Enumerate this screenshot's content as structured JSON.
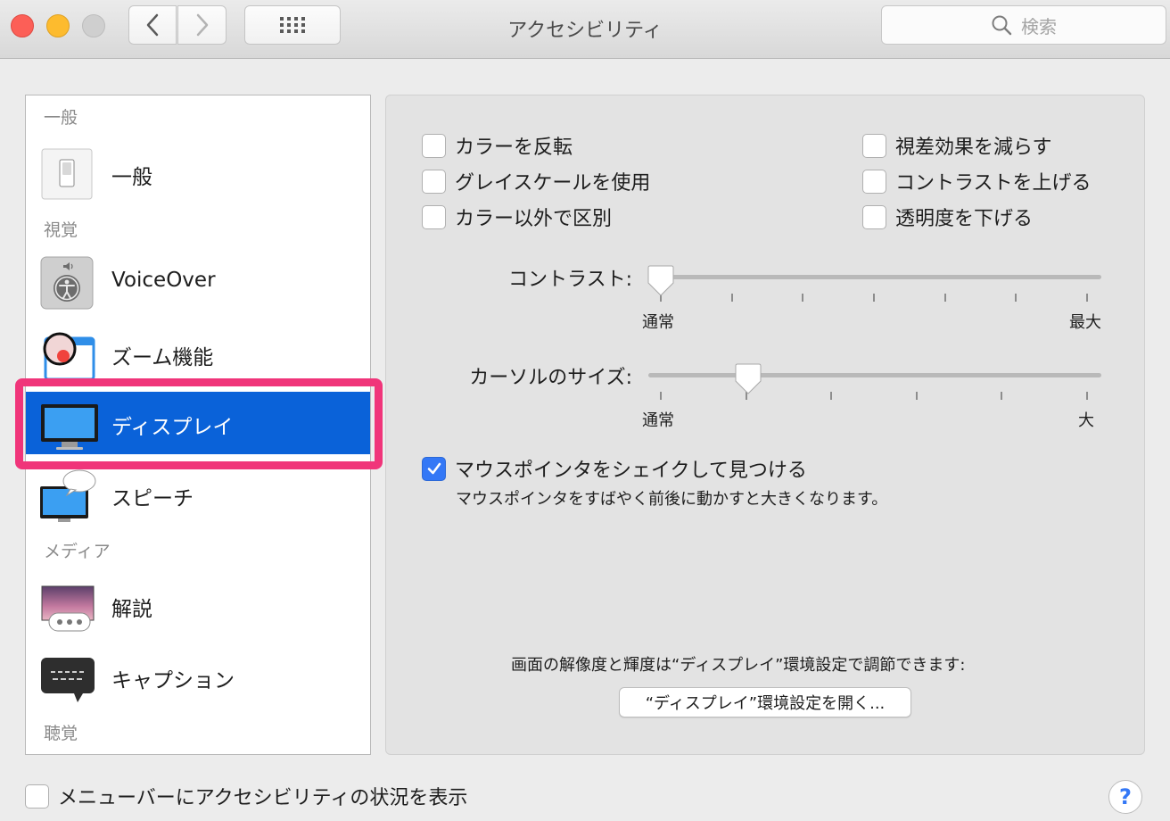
{
  "window": {
    "title": "アクセシビリティ",
    "search_placeholder": "検索"
  },
  "sidebar": {
    "sections": [
      {
        "title": "一般"
      },
      {
        "title": "視覚"
      },
      {
        "title": "メディア"
      },
      {
        "title": "聴覚"
      }
    ],
    "items": [
      {
        "label": "一般",
        "icon": "switch-icon"
      },
      {
        "label": "VoiceOver",
        "icon": "voiceover-icon"
      },
      {
        "label": "ズーム機能",
        "icon": "zoom-icon"
      },
      {
        "label": "ディスプレイ",
        "icon": "display-icon",
        "selected": true
      },
      {
        "label": "スピーチ",
        "icon": "speech-icon"
      },
      {
        "label": "解説",
        "icon": "descriptions-icon"
      },
      {
        "label": "キャプション",
        "icon": "captions-icon"
      }
    ]
  },
  "display": {
    "checkboxes": [
      {
        "label": "カラーを反転",
        "checked": false
      },
      {
        "label": "グレイスケールを使用",
        "checked": false
      },
      {
        "label": "カラー以外で区別",
        "checked": false
      },
      {
        "label": "視差効果を減らす",
        "checked": false
      },
      {
        "label": "コントラストを上げる",
        "checked": false
      },
      {
        "label": "透明度を下げる",
        "checked": false
      }
    ],
    "contrast": {
      "label": "コントラスト:",
      "min_label": "通常",
      "max_label": "最大",
      "value": 0.0
    },
    "cursor_size": {
      "label": "カーソルのサイズ:",
      "min_label": "通常",
      "max_label": "大",
      "value": 0.2
    },
    "shake": {
      "label": "マウスポインタをシェイクして見つける",
      "description": "マウスポインタをすばやく前後に動かすと大きくなります。",
      "checked": true
    },
    "resolution_note": "画面の解像度と輝度は“ディスプレイ”環境設定で調節できます:",
    "open_button": "“ディスプレイ”環境設定を開く..."
  },
  "footer": {
    "menubar_checkbox_label": "メニューバーにアクセシビリティの状況を表示",
    "menubar_checked": false,
    "help": "?"
  },
  "colors": {
    "selection": "#0a62d9",
    "highlight_annotation": "#f0357a",
    "checkbox_checked": "#3478f6"
  }
}
